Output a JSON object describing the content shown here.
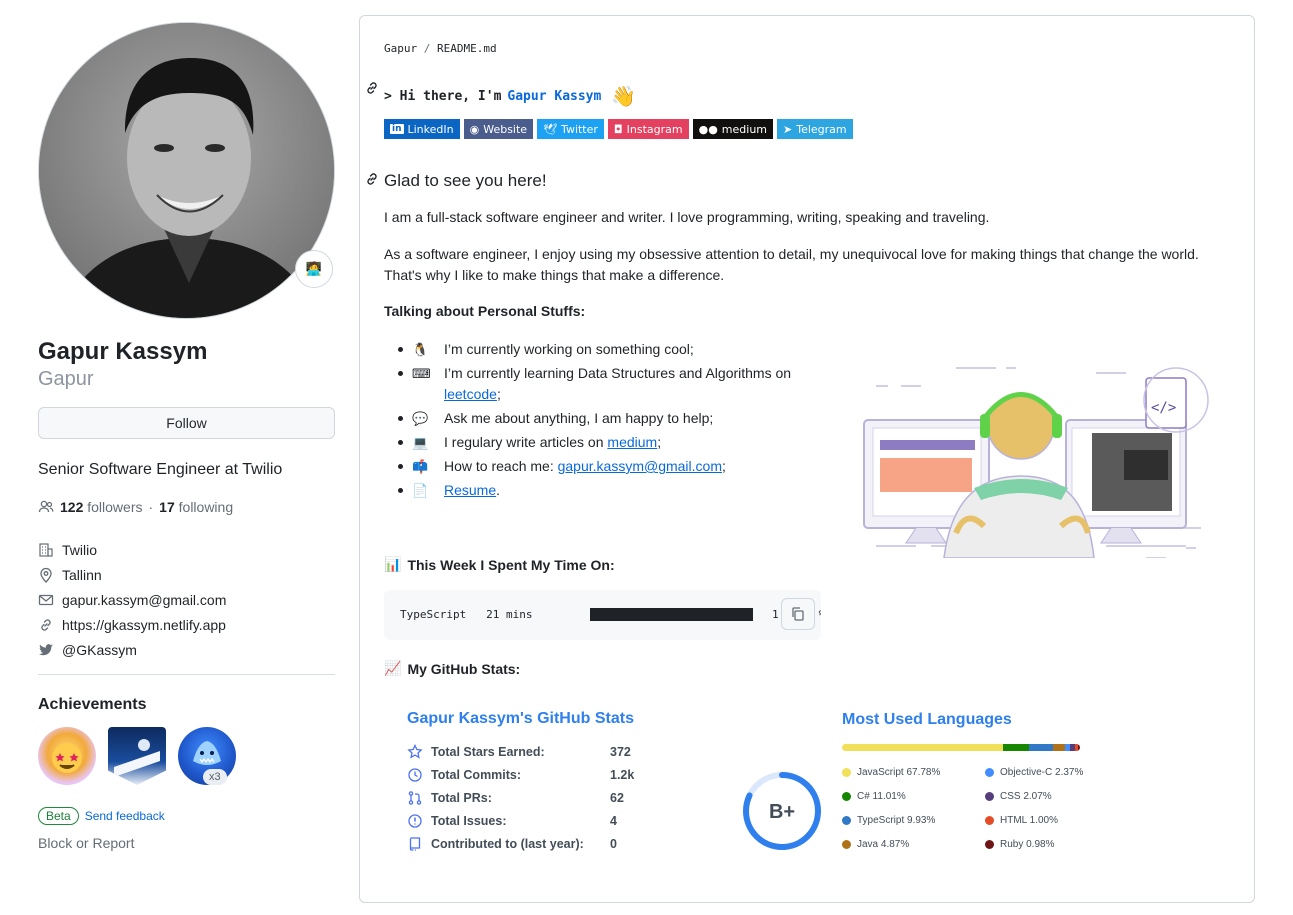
{
  "profile": {
    "full_name": "Gapur Kassym",
    "login": "Gapur",
    "follow_label": "Follow",
    "bio": "Senior Software Engineer at Twilio",
    "followers_count": "122",
    "followers_label": "followers",
    "separator": "·",
    "following_count": "17",
    "following_label": "following",
    "company": "Twilio",
    "location": "Tallinn",
    "email": "gapur.kassym@gmail.com",
    "website": "https://gkassym.netlify.app",
    "twitter": "@GKassym",
    "achievements_title": "Achievements",
    "achievement_multiplier": "x3",
    "beta_label": "Beta",
    "feedback_label": "Send feedback",
    "block_label": "Block or Report"
  },
  "readme": {
    "path_owner": "Gapur",
    "path_sep": "/",
    "path_file": "README.md",
    "hi_prefix": "> Hi there, I'm",
    "hi_name": "Gapur Kassym",
    "socials": [
      {
        "label": "LinkedIn",
        "color": "#0a66c2"
      },
      {
        "label": "Website",
        "color": "#4a5d8c"
      },
      {
        "label": "Twitter",
        "color": "#1da1f2"
      },
      {
        "label": "Instagram",
        "color": "#e4405f"
      },
      {
        "label": "medium",
        "color": "#12100e"
      },
      {
        "label": "Telegram",
        "color": "#2ca5e0"
      }
    ],
    "heading": "Glad to see you here!",
    "para1": "I am a full-stack software engineer and writer. I love programming, writing, speaking and traveling.",
    "para2": "As a software engineer, I enjoy using my obsessive attention to detail, my unequivocal love for making things that change the world. That's why I like to make things that make a difference.",
    "talking_title": "Talking about Personal Stuffs:",
    "items": {
      "working": "I’m currently working on something cool;",
      "learning": "I’m currently learning Data Structures and Algorithms on",
      "learning_link": "leetcode",
      "learning_end": ";",
      "ask": "Ask me about anything, I am happy to help;",
      "articles": "I regulary write articles on",
      "articles_link": "medium",
      "articles_end": ";",
      "reach": "How to reach me:",
      "reach_link": "gapur.kassym@gmail.com",
      "reach_end": ";",
      "resume_link": "Resume",
      "resume_end": "."
    },
    "week_title": "This Week I Spent My Time On:",
    "code_language": "TypeScript",
    "code_time": "21 mins",
    "code_percent": "1",
    "code_percent_tail": "%",
    "code_percent_value": 100,
    "github_stats_title": "My GitHub Stats:",
    "stats_card": {
      "title": "Gapur Kassym's GitHub Stats",
      "rows": [
        {
          "label": "Total Stars Earned:",
          "value": "372",
          "icon": "star-icon"
        },
        {
          "label": "Total Commits:",
          "value": "1.2k",
          "icon": "history-icon"
        },
        {
          "label": "Total PRs:",
          "value": "62",
          "icon": "pull-request-icon"
        },
        {
          "label": "Total Issues:",
          "value": "4",
          "icon": "issue-icon"
        },
        {
          "label": "Contributed to (last year):",
          "value": "0",
          "icon": "repo-icon"
        }
      ],
      "grade": "B+",
      "grade_progress": 0.82,
      "accent": "#2f80ed"
    },
    "languages_card": {
      "title": "Most Used Languages",
      "languages": [
        {
          "name": "JavaScript",
          "percent": "67.78%",
          "value": 67.78,
          "color": "#f1e05a"
        },
        {
          "name": "Objective-C",
          "percent": "2.37%",
          "value": 2.37,
          "color": "#438eff"
        },
        {
          "name": "C#",
          "percent": "11.01%",
          "value": 11.01,
          "color": "#178600"
        },
        {
          "name": "CSS",
          "percent": "2.07%",
          "value": 2.07,
          "color": "#563d7c"
        },
        {
          "name": "TypeScript",
          "percent": "9.93%",
          "value": 9.93,
          "color": "#3178c6"
        },
        {
          "name": "HTML",
          "percent": "1.00%",
          "value": 1.0,
          "color": "#e34c26"
        },
        {
          "name": "Java",
          "percent": "4.87%",
          "value": 4.87,
          "color": "#b07219"
        },
        {
          "name": "Ruby",
          "percent": "0.98%",
          "value": 0.98,
          "color": "#701516"
        }
      ]
    }
  }
}
